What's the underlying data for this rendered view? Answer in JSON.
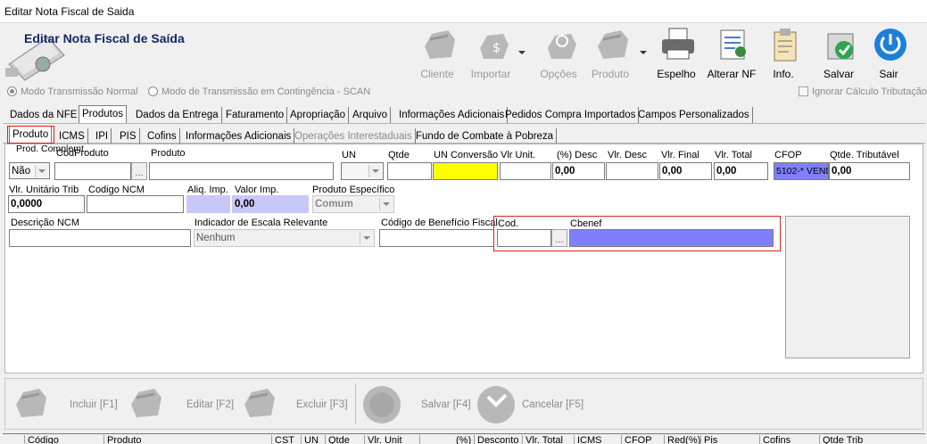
{
  "window": {
    "title": "Editar Nota Fiscal de Saida"
  },
  "header": {
    "title": "Editar Nota Fiscal de Saída"
  },
  "toolbar": [
    {
      "label": "Cliente",
      "icon": "hand-icon",
      "enabled": false
    },
    {
      "label": "Importar",
      "icon": "money-bag-icon",
      "enabled": false,
      "dropdown": true
    },
    {
      "label": "Opções",
      "icon": "gear-hand-icon",
      "enabled": false
    },
    {
      "label": "Produto",
      "icon": "product-hand-icon",
      "enabled": false,
      "dropdown": true
    },
    {
      "label": "Espelho",
      "icon": "printer-icon",
      "enabled": true
    },
    {
      "label": "Alterar NF",
      "icon": "edit-document-icon",
      "enabled": true
    },
    {
      "label": "Info.",
      "icon": "clipboard-icon",
      "enabled": true
    },
    {
      "label": "Salvar",
      "icon": "save-check-icon",
      "enabled": true
    },
    {
      "label": "Sair",
      "icon": "power-icon",
      "enabled": true
    }
  ],
  "mode": {
    "normal": "Modo Transmissão Normal",
    "contingencia": "Modo de Transmissão em Contingência - SCAN",
    "ignorar": "Ignorar Cálculo Tributação"
  },
  "main_tabs": [
    "Dados da NFE",
    "Produtos",
    "Dados da Entrega",
    "Faturamento",
    "Apropriação",
    "Arquivo",
    "Informações Adicionais",
    "Pedidos Compra Importados",
    "Campos Personalizados"
  ],
  "sub_tabs": [
    "Produto",
    "ICMS",
    "IPI",
    "PIS",
    "Cofins",
    "Informações Adicionais",
    "Operações Interestaduais",
    "Fundo de Combate à Pobreza"
  ],
  "form": {
    "prod_complement_label": "Prod. Complemt.",
    "prod_complement_value": "Não",
    "cod_produto_label": "CodProduto",
    "produto_label": "Produto",
    "un_label": "UN",
    "qtde_label": "Qtde",
    "un_conversao_label": "UN Conversão",
    "vlr_unit_label": "Vlr Unit.",
    "desc_pct_label": "(%) Desc",
    "desc_pct_value": "0,00",
    "vlr_desc_label": "Vlr. Desc",
    "vlr_final_label": "Vlr. Final",
    "vlr_final_value": "0,00",
    "vlr_total_label": "Vlr. Total",
    "vlr_total_value": "0,00",
    "cfop_label": "CFOP",
    "cfop_value": "5102-* VENDA",
    "qtde_trib_label": "Qtde. Tributável",
    "qtde_trib_value": "0,00",
    "vlr_unit_trib_label": "Vlr. Unitário Trib",
    "vlr_unit_trib_value": "0,0000",
    "codigo_ncm_label": "Codigo NCM",
    "aliq_imp_label": "Aliq. Imp.",
    "valor_imp_label": "Valor Imp.",
    "valor_imp_value": "0,00",
    "produto_especifico_label": "Produto Específico",
    "produto_especifico_value": "Comum",
    "descricao_ncm_label": "Descrição NCM",
    "escala_label": "Indicador de Escala Relevante",
    "escala_value": "Nenhum",
    "beneficio_label": "Código de Benefício Fiscal",
    "cod_label": "Cod.",
    "cbenef_label": "Cbenef",
    "ellipsis": "..."
  },
  "bottom_toolbar": [
    {
      "label": "Incluir [F1]",
      "icon": "hand-icon"
    },
    {
      "label": "Editar [F2]",
      "icon": "hand-edit-icon"
    },
    {
      "label": "Excluir [F3]",
      "icon": "hand-delete-icon"
    },
    {
      "label": "Salvar [F4]",
      "icon": "save-circle-icon"
    },
    {
      "label": "Cancelar [F5]",
      "icon": "cancel-circle-icon"
    }
  ],
  "grid_columns": [
    "Código",
    "Produto",
    "CST",
    "UN",
    "Qtde",
    "Vlr. Unit",
    "(%)",
    "Desconto",
    "Vlr. Total",
    "ICMS",
    "CFOP",
    "Red(%)",
    "Pis",
    "Cofins",
    "Qtde Trib"
  ],
  "colors": {
    "yellow": "#ffff00",
    "lavender": "#8080ff",
    "highlight": "#e02020"
  }
}
